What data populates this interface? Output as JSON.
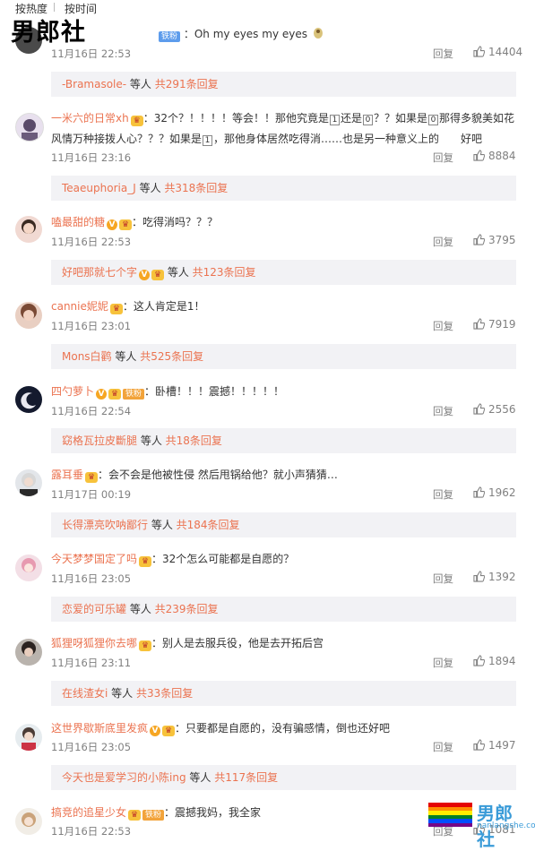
{
  "sort_tabs": {
    "by_hot": "按热度",
    "by_time": "按时间"
  },
  "watermark": "男郎社",
  "bottom_logo": {
    "text": "男郎社",
    "url": "nanlangshe.com"
  },
  "reply_label": "回复",
  "comments": [
    {
      "user": "男郎社",
      "fan_badge": "铁粉",
      "text": "：Oh my eyes my eyes",
      "time": "11月16日 22:53",
      "likes": "14404",
      "replies": {
        "who": "-Bramasole-",
        "mid": " 等人 ",
        "count": "共291条回复"
      }
    },
    {
      "user": "一米六的日常xh",
      "text_a": "：32个？！！！！等会！！那他究竟是",
      "box1": "1",
      "text_b": "还是",
      "box2": "0",
      "text_c": "？？如果是",
      "box3": "0",
      "text_d": "那得多貌美如花",
      "text_line2a": "风情万种接拨人心？？？如果是",
      "box4": "1",
      "text_line2b": "，那他身体居然吃得消……也是另一种意义上的",
      "text_line2c": "好吧",
      "time": "11月16日 23:16",
      "likes": "8884",
      "replies": {
        "who": "Teaeuphoria_J",
        "mid": " 等人 ",
        "count": "共318条回复"
      }
    },
    {
      "user": "嗑最甜的糖",
      "text": "：吃得消吗？？？",
      "time": "11月16日 22:53",
      "likes": "3795",
      "replies": {
        "who": "好吧那就七个字",
        "mid": " 等人 ",
        "count": "共123条回复"
      }
    },
    {
      "user": "cannie妮妮",
      "text": "：这人肯定是1！",
      "time": "11月16日 23:01",
      "likes": "7919",
      "replies": {
        "who": "Mons白鹳",
        "mid": " 等人 ",
        "count": "共525条回复"
      }
    },
    {
      "user": "四勺萝卜",
      "fan_badge": "铁粉",
      "text": "：卧槽！！！震撼！！！！！",
      "time": "11月16日 22:54",
      "likes": "2556",
      "replies": {
        "who": "窈格瓦拉皮斷腿",
        "mid": " 等人 ",
        "count": "共18条回复"
      }
    },
    {
      "user": "露耳垂",
      "text": "：会不会是他被性侵 然后甩锅给他？就小声猜猜…",
      "time": "11月17日 00:19",
      "likes": "1962",
      "replies": {
        "who": "长得漂亮吹呐鄙行",
        "mid": " 等人 ",
        "count": "共184条回复"
      }
    },
    {
      "user": "今天梦梦国定了吗",
      "text": "：32个怎么可能都是自愿的？",
      "time": "11月16日 23:05",
      "likes": "1392",
      "replies": {
        "who": "恋爱的可乐罐",
        "mid": " 等人 ",
        "count": "共239条回复"
      }
    },
    {
      "user": "狐狸呀狐狸你去哪",
      "text": "：别人是去服兵役，他是去开拓后宫",
      "time": "11月16日 23:11",
      "likes": "1894",
      "replies": {
        "who": "在线渣女i",
        "mid": " 等人 ",
        "count": "共33条回复"
      }
    },
    {
      "user": "这世界歇斯底里发疯",
      "text": "：只要都是自愿的，没有骗感情，倒也还好吧",
      "time": "11月16日 23:05",
      "likes": "1497",
      "replies": {
        "who": "今天也是爱学习的小陈ing",
        "mid": " 等人 ",
        "count": "共117条回复"
      }
    },
    {
      "user": "搞竞的追星少女",
      "fan_badge": "铁粉",
      "text": "：震撼我妈，我全家",
      "time": "11月16日 22:53",
      "likes": "1081"
    }
  ]
}
